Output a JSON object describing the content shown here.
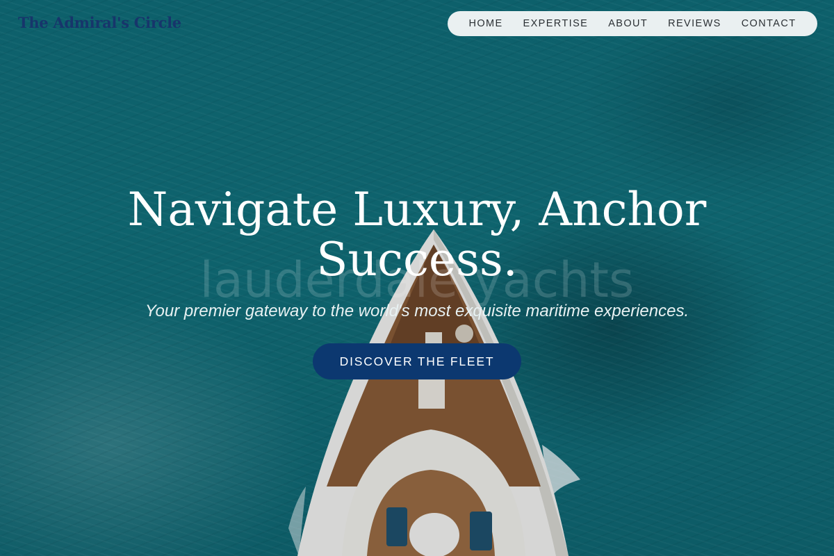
{
  "brand": {
    "name": "The Admiral's Circle"
  },
  "nav": {
    "items": [
      {
        "label": "HOME"
      },
      {
        "label": "EXPERTISE"
      },
      {
        "label": "ABOUT"
      },
      {
        "label": "REVIEWS"
      },
      {
        "label": "CONTACT"
      }
    ]
  },
  "hero": {
    "watermark": "lauderdale yachts",
    "headline_line1": "Navigate Luxury, Anchor",
    "headline_line2": "Success.",
    "tagline": "Your premier gateway to the world's most exquisite maritime experiences.",
    "cta_label": "DISCOVER THE FLEET"
  },
  "colors": {
    "ocean": "#0f6c76",
    "brand_navy": "#17356b",
    "cta_background": "#0c3870",
    "nav_background": "#eaf0f1"
  }
}
